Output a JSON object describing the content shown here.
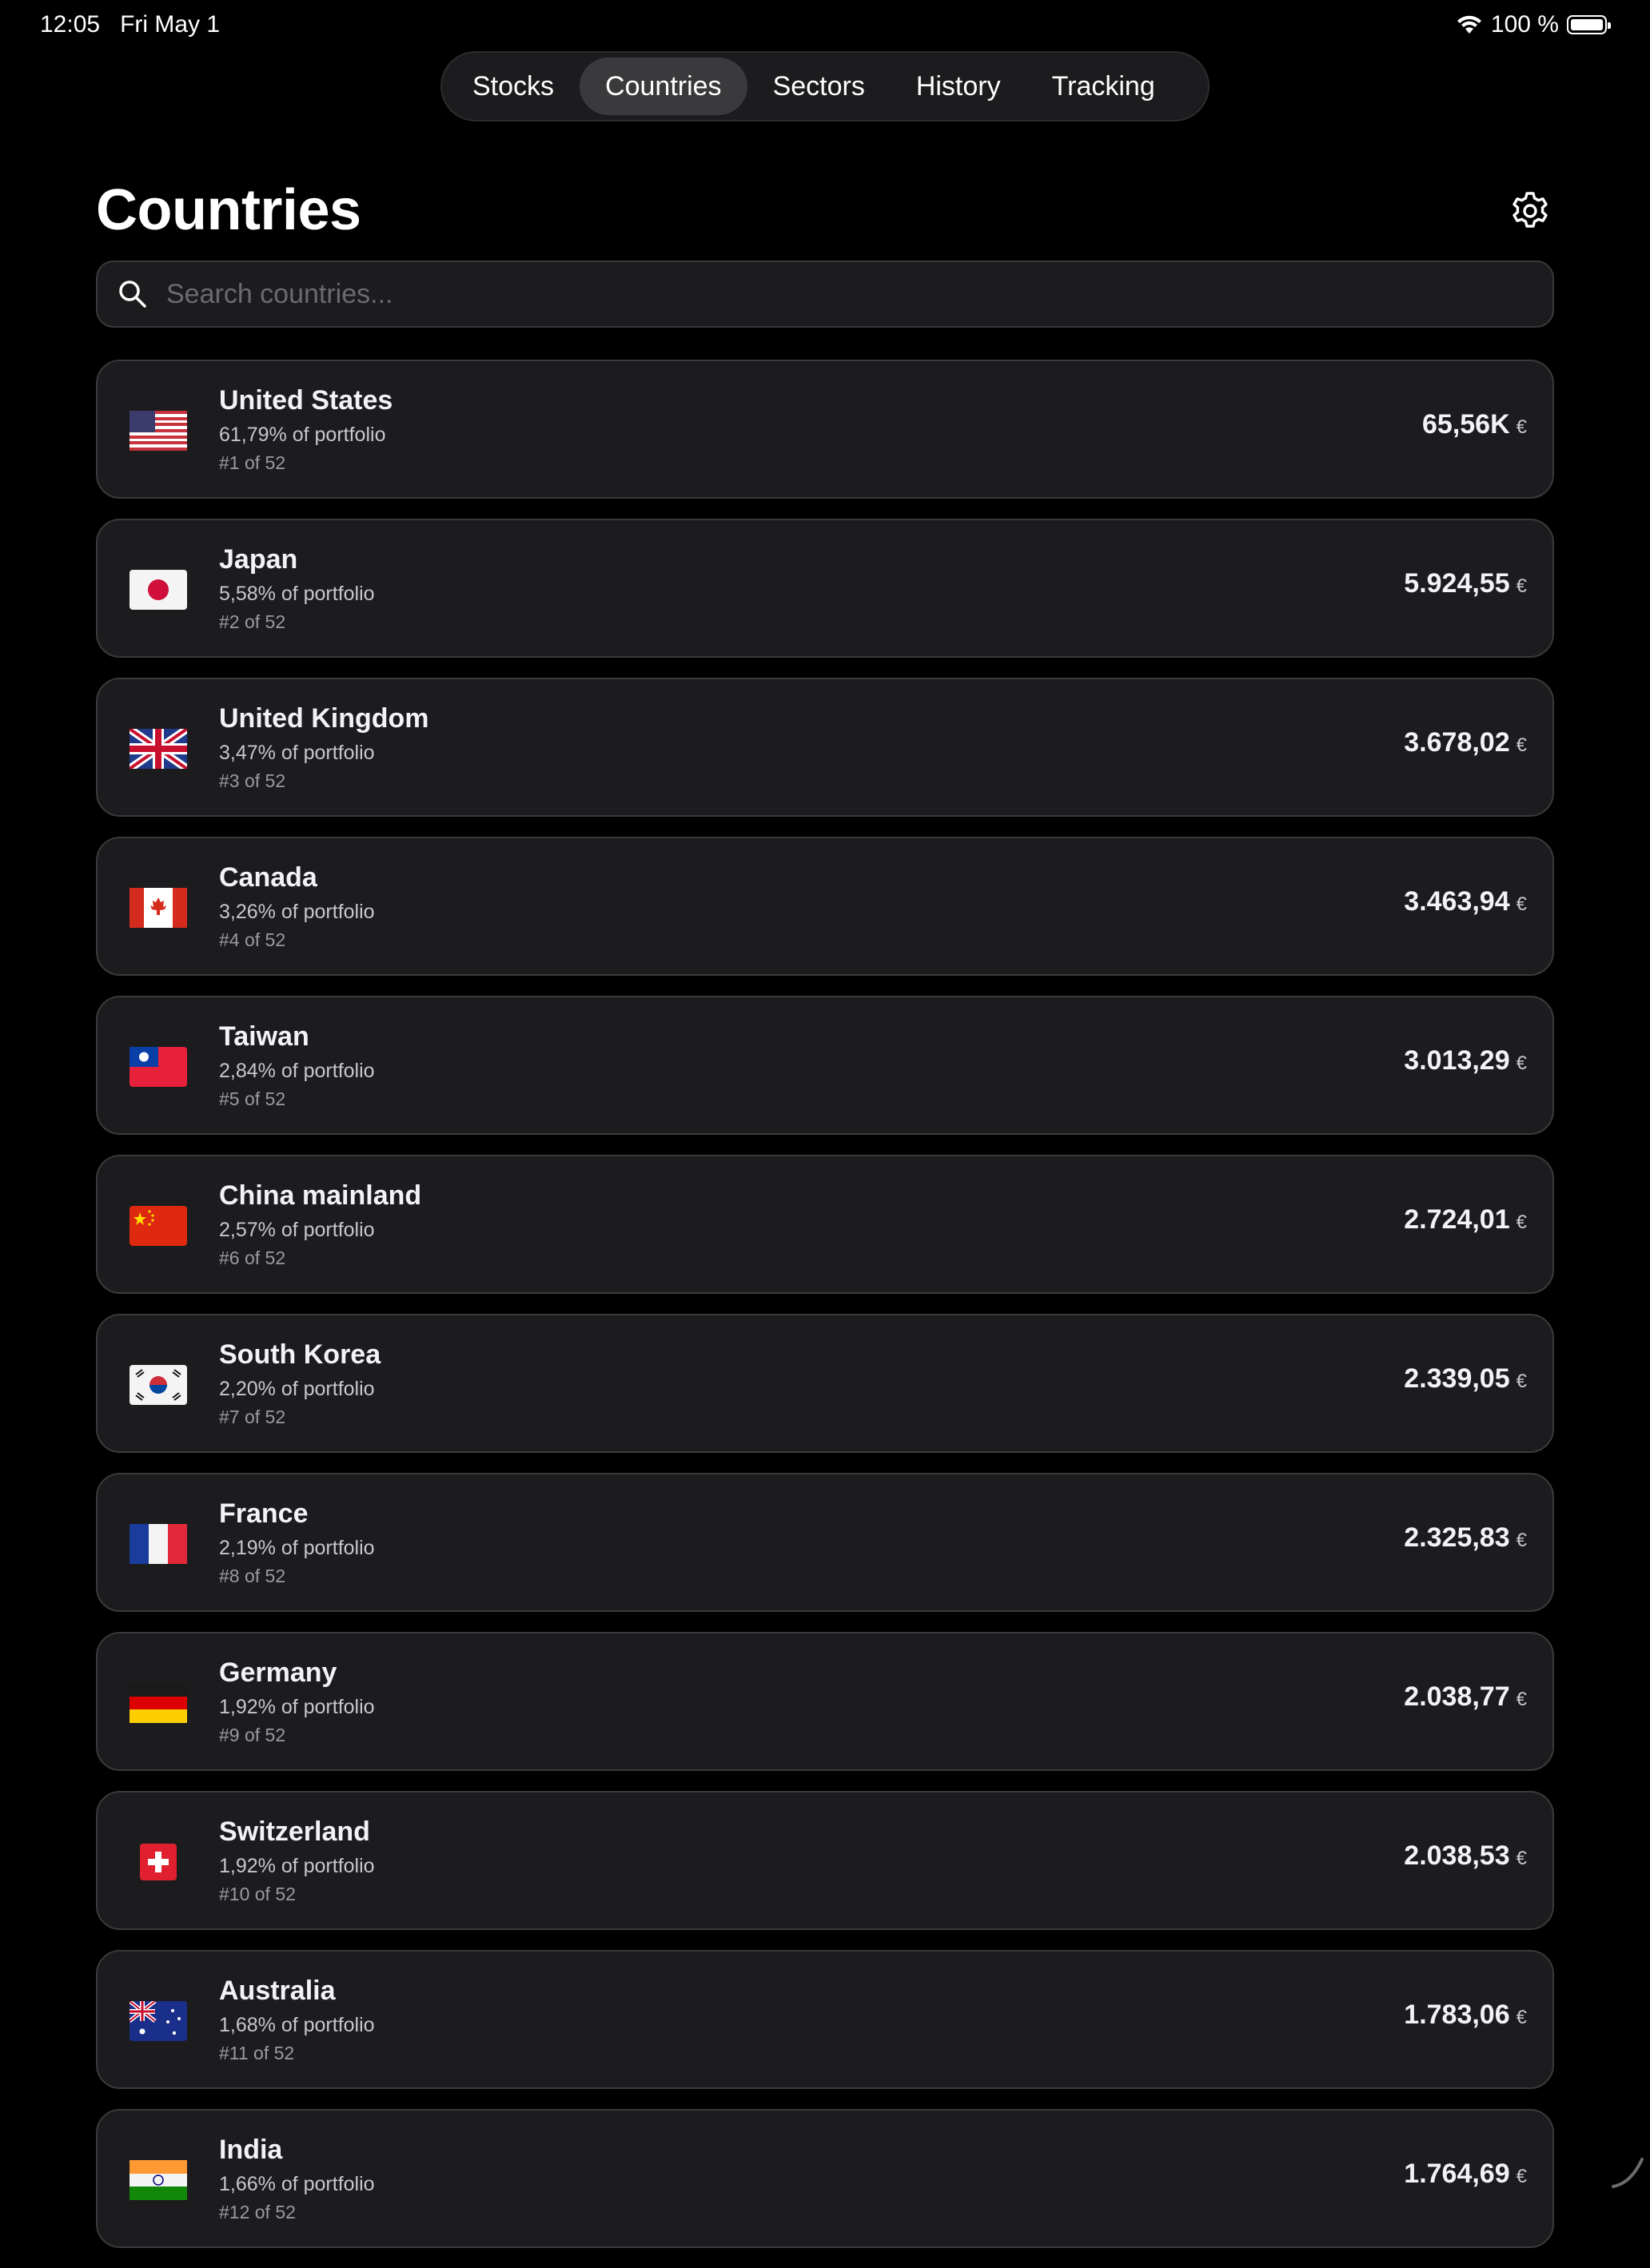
{
  "status_bar": {
    "time": "12:05",
    "date": "Fri May 1",
    "battery": "100 %"
  },
  "tabs": [
    {
      "label": "Stocks",
      "selected": false
    },
    {
      "label": "Countries",
      "selected": true
    },
    {
      "label": "Sectors",
      "selected": false
    },
    {
      "label": "History",
      "selected": false
    },
    {
      "label": "Tracking",
      "selected": false
    }
  ],
  "header": {
    "title": "Countries",
    "settings_icon": "gear-icon"
  },
  "search": {
    "placeholder": "Search countries...",
    "value": ""
  },
  "currency": "€",
  "countries": [
    {
      "name": "United States",
      "share": "61,79% of portfolio",
      "rank": "#1 of 52",
      "value": "65,56K",
      "flag": "us"
    },
    {
      "name": "Japan",
      "share": "5,58% of portfolio",
      "rank": "#2 of 52",
      "value": "5.924,55",
      "flag": "jp"
    },
    {
      "name": "United Kingdom",
      "share": "3,47% of portfolio",
      "rank": "#3 of 52",
      "value": "3.678,02",
      "flag": "gb"
    },
    {
      "name": "Canada",
      "share": "3,26% of portfolio",
      "rank": "#4 of 52",
      "value": "3.463,94",
      "flag": "ca"
    },
    {
      "name": "Taiwan",
      "share": "2,84% of portfolio",
      "rank": "#5 of 52",
      "value": "3.013,29",
      "flag": "tw"
    },
    {
      "name": "China mainland",
      "share": "2,57% of portfolio",
      "rank": "#6 of 52",
      "value": "2.724,01",
      "flag": "cn"
    },
    {
      "name": "South Korea",
      "share": "2,20% of portfolio",
      "rank": "#7 of 52",
      "value": "2.339,05",
      "flag": "kr"
    },
    {
      "name": "France",
      "share": "2,19% of portfolio",
      "rank": "#8 of 52",
      "value": "2.325,83",
      "flag": "fr"
    },
    {
      "name": "Germany",
      "share": "1,92% of portfolio",
      "rank": "#9 of 52",
      "value": "2.038,77",
      "flag": "de"
    },
    {
      "name": "Switzerland",
      "share": "1,92% of portfolio",
      "rank": "#10 of 52",
      "value": "2.038,53",
      "flag": "ch"
    },
    {
      "name": "Australia",
      "share": "1,68% of portfolio",
      "rank": "#11 of 52",
      "value": "1.783,06",
      "flag": "au"
    },
    {
      "name": "India",
      "share": "1,66% of portfolio",
      "rank": "#12 of 52",
      "value": "1.764,69",
      "flag": "in"
    }
  ]
}
